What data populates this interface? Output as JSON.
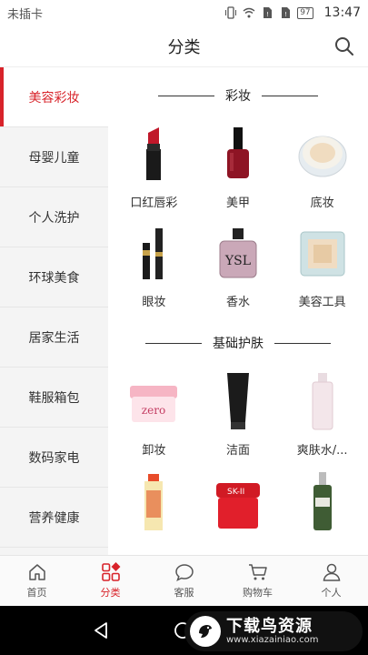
{
  "status_bar": {
    "sim": "未插卡",
    "battery": "97",
    "time": "13:47"
  },
  "header": {
    "title": "分类"
  },
  "sidebar": {
    "items": [
      {
        "label": "美容彩妆"
      },
      {
        "label": "母婴儿童"
      },
      {
        "label": "个人洗护"
      },
      {
        "label": "环球美食"
      },
      {
        "label": "居家生活"
      },
      {
        "label": "鞋服箱包"
      },
      {
        "label": "数码家电"
      },
      {
        "label": "营养健康"
      }
    ],
    "active_index": 0
  },
  "sections": [
    {
      "title": "彩妆",
      "items": [
        {
          "label": "口红唇彩",
          "icon": "lipstick-icon"
        },
        {
          "label": "美甲",
          "icon": "nail-polish-icon"
        },
        {
          "label": "底妆",
          "icon": "cushion-compact-icon"
        },
        {
          "label": "眼妆",
          "icon": "eyeliner-icon"
        },
        {
          "label": "香水",
          "icon": "perfume-bottle-icon"
        },
        {
          "label": "美容工具",
          "icon": "makeup-sponge-icon"
        }
      ]
    },
    {
      "title": "基础护肤",
      "items": [
        {
          "label": "卸妆",
          "icon": "cleansing-balm-jar-icon"
        },
        {
          "label": "洁面",
          "icon": "cleanser-tube-icon"
        },
        {
          "label": "爽肤水/...",
          "icon": "toner-bottle-icon"
        },
        {
          "label": "",
          "icon": "essence-bottle-icon"
        },
        {
          "label": "",
          "icon": "cream-jar-icon"
        },
        {
          "label": "",
          "icon": "serum-bottle-icon"
        }
      ]
    }
  ],
  "tabbar": {
    "items": [
      {
        "label": "首页",
        "icon": "home-icon"
      },
      {
        "label": "分类",
        "icon": "category-icon"
      },
      {
        "label": "客服",
        "icon": "chat-bubble-icon"
      },
      {
        "label": "购物车",
        "icon": "cart-icon"
      },
      {
        "label": "个人",
        "icon": "person-icon"
      }
    ],
    "active_index": 1
  },
  "watermark": {
    "text": "下载鸟资源",
    "url": "www.xiazainiao.com"
  },
  "colors": {
    "accent": "#d8232a",
    "sidebar_bg": "#f4f4f4"
  }
}
